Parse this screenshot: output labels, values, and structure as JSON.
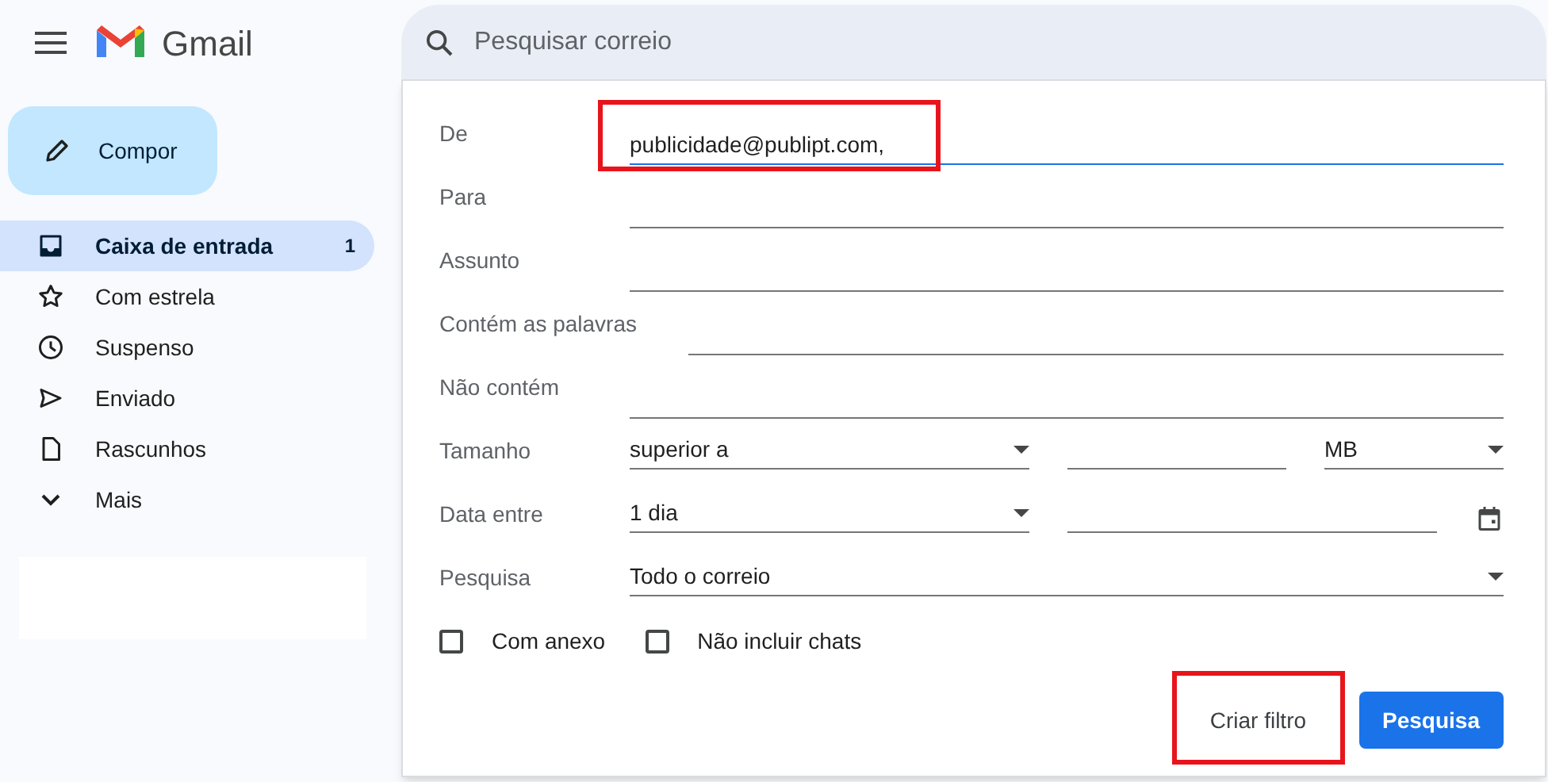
{
  "app": {
    "name": "Gmail"
  },
  "compose": {
    "label": "Compor"
  },
  "nav": [
    {
      "kind": "inbox",
      "label": "Caixa de entrada",
      "count": "1",
      "selected": true
    },
    {
      "kind": "star",
      "label": "Com estrela",
      "selected": false
    },
    {
      "kind": "clock",
      "label": "Suspenso",
      "selected": false
    },
    {
      "kind": "send",
      "label": "Enviado",
      "selected": false
    },
    {
      "kind": "file",
      "label": "Rascunhos",
      "selected": false
    },
    {
      "kind": "more",
      "label": "Mais",
      "selected": false
    }
  ],
  "search": {
    "placeholder": "Pesquisar correio"
  },
  "filter_form": {
    "fields": [
      {
        "kind": "text",
        "label": "De",
        "value": "publicidade@publipt.com,",
        "focused": true,
        "highlighted": true
      },
      {
        "kind": "text",
        "label": "Para",
        "focused": false,
        "highlighted": false
      },
      {
        "kind": "text",
        "label": "Assunto",
        "focused": false,
        "highlighted": false
      },
      {
        "kind": "text",
        "label": "Contém as palavras",
        "focused": false,
        "highlighted": false
      },
      {
        "kind": "text",
        "label": "Não contém",
        "focused": false,
        "highlighted": false
      },
      {
        "kind": "size",
        "label": "Tamanho",
        "operator": "superior a",
        "unit": "MB"
      },
      {
        "kind": "date",
        "label": "Data entre",
        "range": "1 dia"
      },
      {
        "kind": "select",
        "label": "Pesquisa",
        "value": "Todo o correio"
      }
    ],
    "checkboxes": [
      {
        "label": "Com anexo",
        "checked": false
      },
      {
        "label": "Não incluir chats",
        "checked": false
      }
    ],
    "buttons": [
      {
        "kind": "text",
        "label": "Criar filtro",
        "highlighted": true
      },
      {
        "kind": "primary",
        "label": "Pesquisa",
        "highlighted": false
      }
    ]
  }
}
